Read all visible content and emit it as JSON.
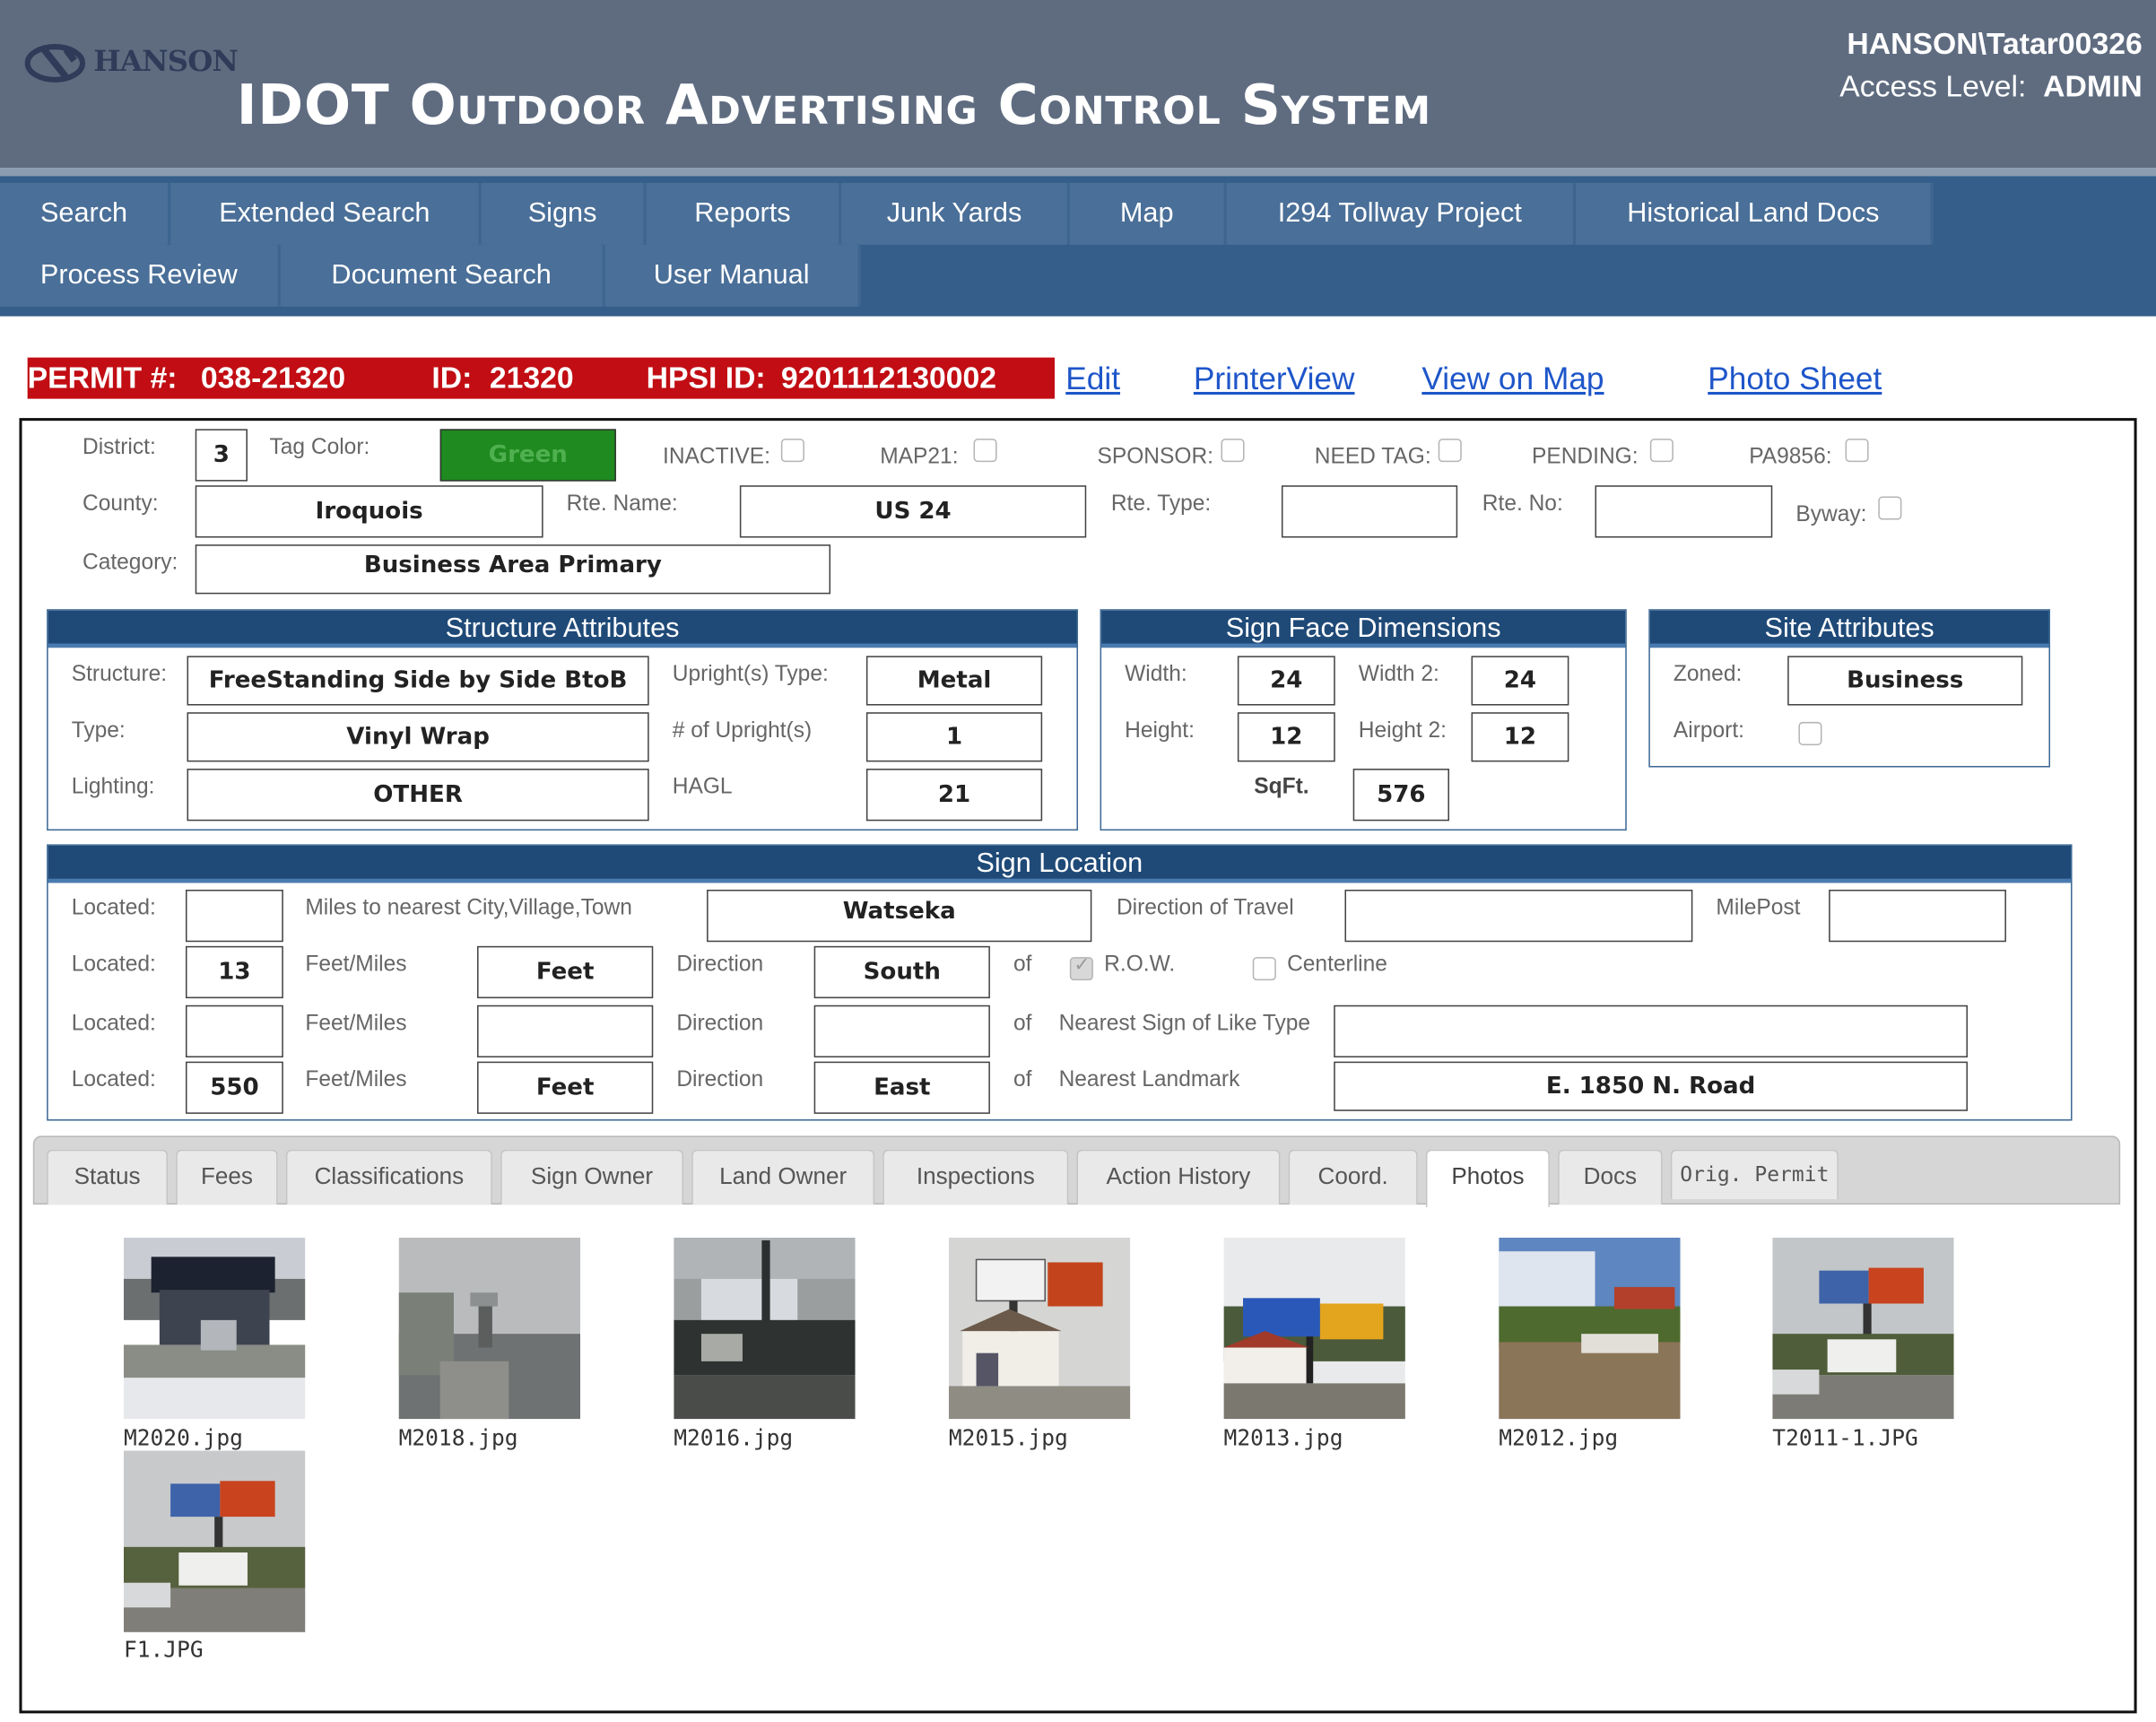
{
  "header": {
    "logo_text": "HANSON",
    "title": "IDOT Outdoor Advertising Control System",
    "user": "HANSON\\Tatar00326",
    "access_label": "Access Level:",
    "access_value": "ADMIN"
  },
  "nav": {
    "row1": [
      "Search",
      "Extended Search",
      "Signs",
      "Reports",
      "Junk Yards",
      "Map",
      "I294 Tollway Project",
      "Historical Land Docs"
    ],
    "row2": [
      "Process Review",
      "Document Search",
      "User Manual"
    ]
  },
  "permit": {
    "permit_label": "PERMIT #:",
    "permit_no": "038-21320",
    "id_label": "ID:",
    "id": "21320",
    "hpsi_label": "HPSI ID:",
    "hpsi_id": "9201112130002",
    "links": [
      "Edit",
      "PrinterView",
      "View on Map",
      "Photo Sheet"
    ]
  },
  "general": {
    "district_label": "District:",
    "district": "3",
    "tag_color_label": "Tag Color:",
    "tag_color": "Green",
    "tag_color_hex": "#1f8a1f",
    "inactive_label": "INACTIVE:",
    "map21_label": "MAP21:",
    "sponsor_label": "SPONSOR:",
    "need_tag_label": "NEED TAG:",
    "pending_label": "PENDING:",
    "pa9856_label": "PA9856:",
    "county_label": "County:",
    "county": "Iroquois",
    "rte_name_label": "Rte. Name:",
    "rte_name": "US 24",
    "rte_type_label": "Rte. Type:",
    "rte_type": "",
    "rte_no_label": "Rte. No:",
    "rte_no": "",
    "byway_label": "Byway:",
    "category_label": "Category:",
    "category": "Business Area Primary"
  },
  "structure": {
    "title": "Structure Attributes",
    "structure_label": "Structure:",
    "structure": "FreeStanding Side by Side BtoB",
    "upright_type_label": "Upright(s) Type:",
    "upright_type": "Metal",
    "type_label": "Type:",
    "type": "Vinyl Wrap",
    "num_uprights_label": "# of Upright(s)",
    "num_uprights": "1",
    "lighting_label": "Lighting:",
    "lighting": "OTHER",
    "hagl_label": "HAGL",
    "hagl": "21"
  },
  "dimensions": {
    "title": "Sign Face Dimensions",
    "width_label": "Width:",
    "width": "24",
    "width2_label": "Width 2:",
    "width2": "24",
    "height_label": "Height:",
    "height": "12",
    "height2_label": "Height 2:",
    "height2": "12",
    "sqft_label": "SqFt.",
    "sqft": "576"
  },
  "site": {
    "title": "Site Attributes",
    "zoned_label": "Zoned:",
    "zoned": "Business",
    "airport_label": "Airport:"
  },
  "location": {
    "title": "Sign Location",
    "located_label": "Located:",
    "miles_label": "Miles to nearest City,Village,Town",
    "city": "Watseka",
    "dir_travel_label": "Direction of Travel",
    "dir_travel": "",
    "milepost_label": "MilePost",
    "milepost": "",
    "feet_miles_label": "Feet/Miles",
    "direction_label": "Direction",
    "of_label": "of",
    "row_label": "R.O.W.",
    "centerline_label": "Centerline",
    "nearest_sign_label": "Nearest Sign of Like Type",
    "nearest_landmark_label": "Nearest Landmark",
    "loc1": "",
    "loc2": "13",
    "unit2": "Feet",
    "dir2": "South",
    "loc3": "",
    "unit3": "",
    "dir3": "",
    "nearest_sign": "",
    "loc4": "550",
    "unit4": "Feet",
    "dir4": "East",
    "landmark": "E. 1850 N. Road"
  },
  "tabs": [
    "Status",
    "Fees",
    "Classifications",
    "Sign Owner",
    "Land Owner",
    "Inspections",
    "Action History",
    "Coord.",
    "Photos",
    "Docs",
    "Orig. Permit"
  ],
  "active_tab": "Photos",
  "photos": [
    "M2020.jpg",
    "M2018.jpg",
    "M2016.jpg",
    "M2015.jpg",
    "M2013.jpg",
    "M2012.jpg",
    "T2011-1.JPG",
    "F1.JPG"
  ]
}
